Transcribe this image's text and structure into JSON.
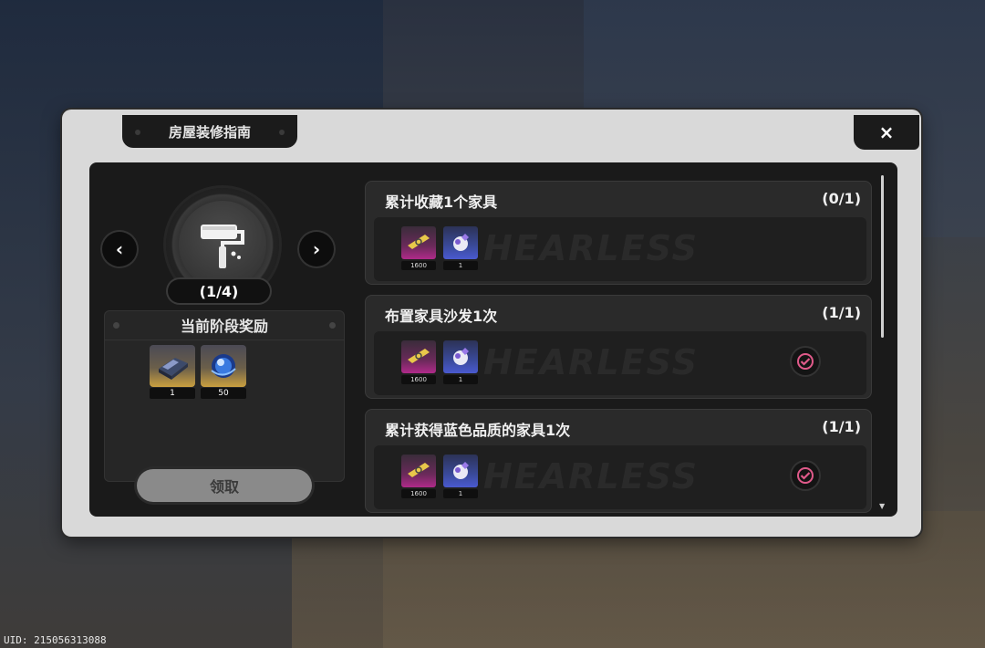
{
  "window": {
    "title": "房屋装修指南",
    "close_label": "×"
  },
  "stage": {
    "progress": "(1/4)",
    "prev_label": "‹",
    "next_label": "›",
    "icon": "paint-roller-icon"
  },
  "current_reward": {
    "heading": "当前阶段奖励",
    "items": [
      {
        "icon": "bed-item-icon",
        "count": "1"
      },
      {
        "icon": "blue-orb-item-icon",
        "count": "50"
      }
    ],
    "claim_label": "领取"
  },
  "tasks": [
    {
      "title": "累计收藏1个家具",
      "progress": "(0/1)",
      "completed": false,
      "rewards": [
        {
          "icon": "ticket-icon",
          "count": "1600"
        },
        {
          "icon": "crystal-icon",
          "count": "1"
        }
      ]
    },
    {
      "title": "布置家具沙发1次",
      "progress": "(1/1)",
      "completed": true,
      "rewards": [
        {
          "icon": "ticket-icon",
          "count": "1600"
        },
        {
          "icon": "crystal-icon",
          "count": "1"
        }
      ]
    },
    {
      "title": "累计获得蓝色品质的家具1次",
      "progress": "(1/1)",
      "completed": true,
      "rewards": [
        {
          "icon": "ticket-icon",
          "count": "1600"
        },
        {
          "icon": "crystal-icon",
          "count": "1"
        }
      ]
    }
  ],
  "watermark": "HEARLESS",
  "uid": "UID: 215056313088",
  "colors": {
    "accent_pink": "#e05a8a",
    "panel_bg": "#d9d9d9",
    "inner_bg": "#1a1a1a"
  }
}
